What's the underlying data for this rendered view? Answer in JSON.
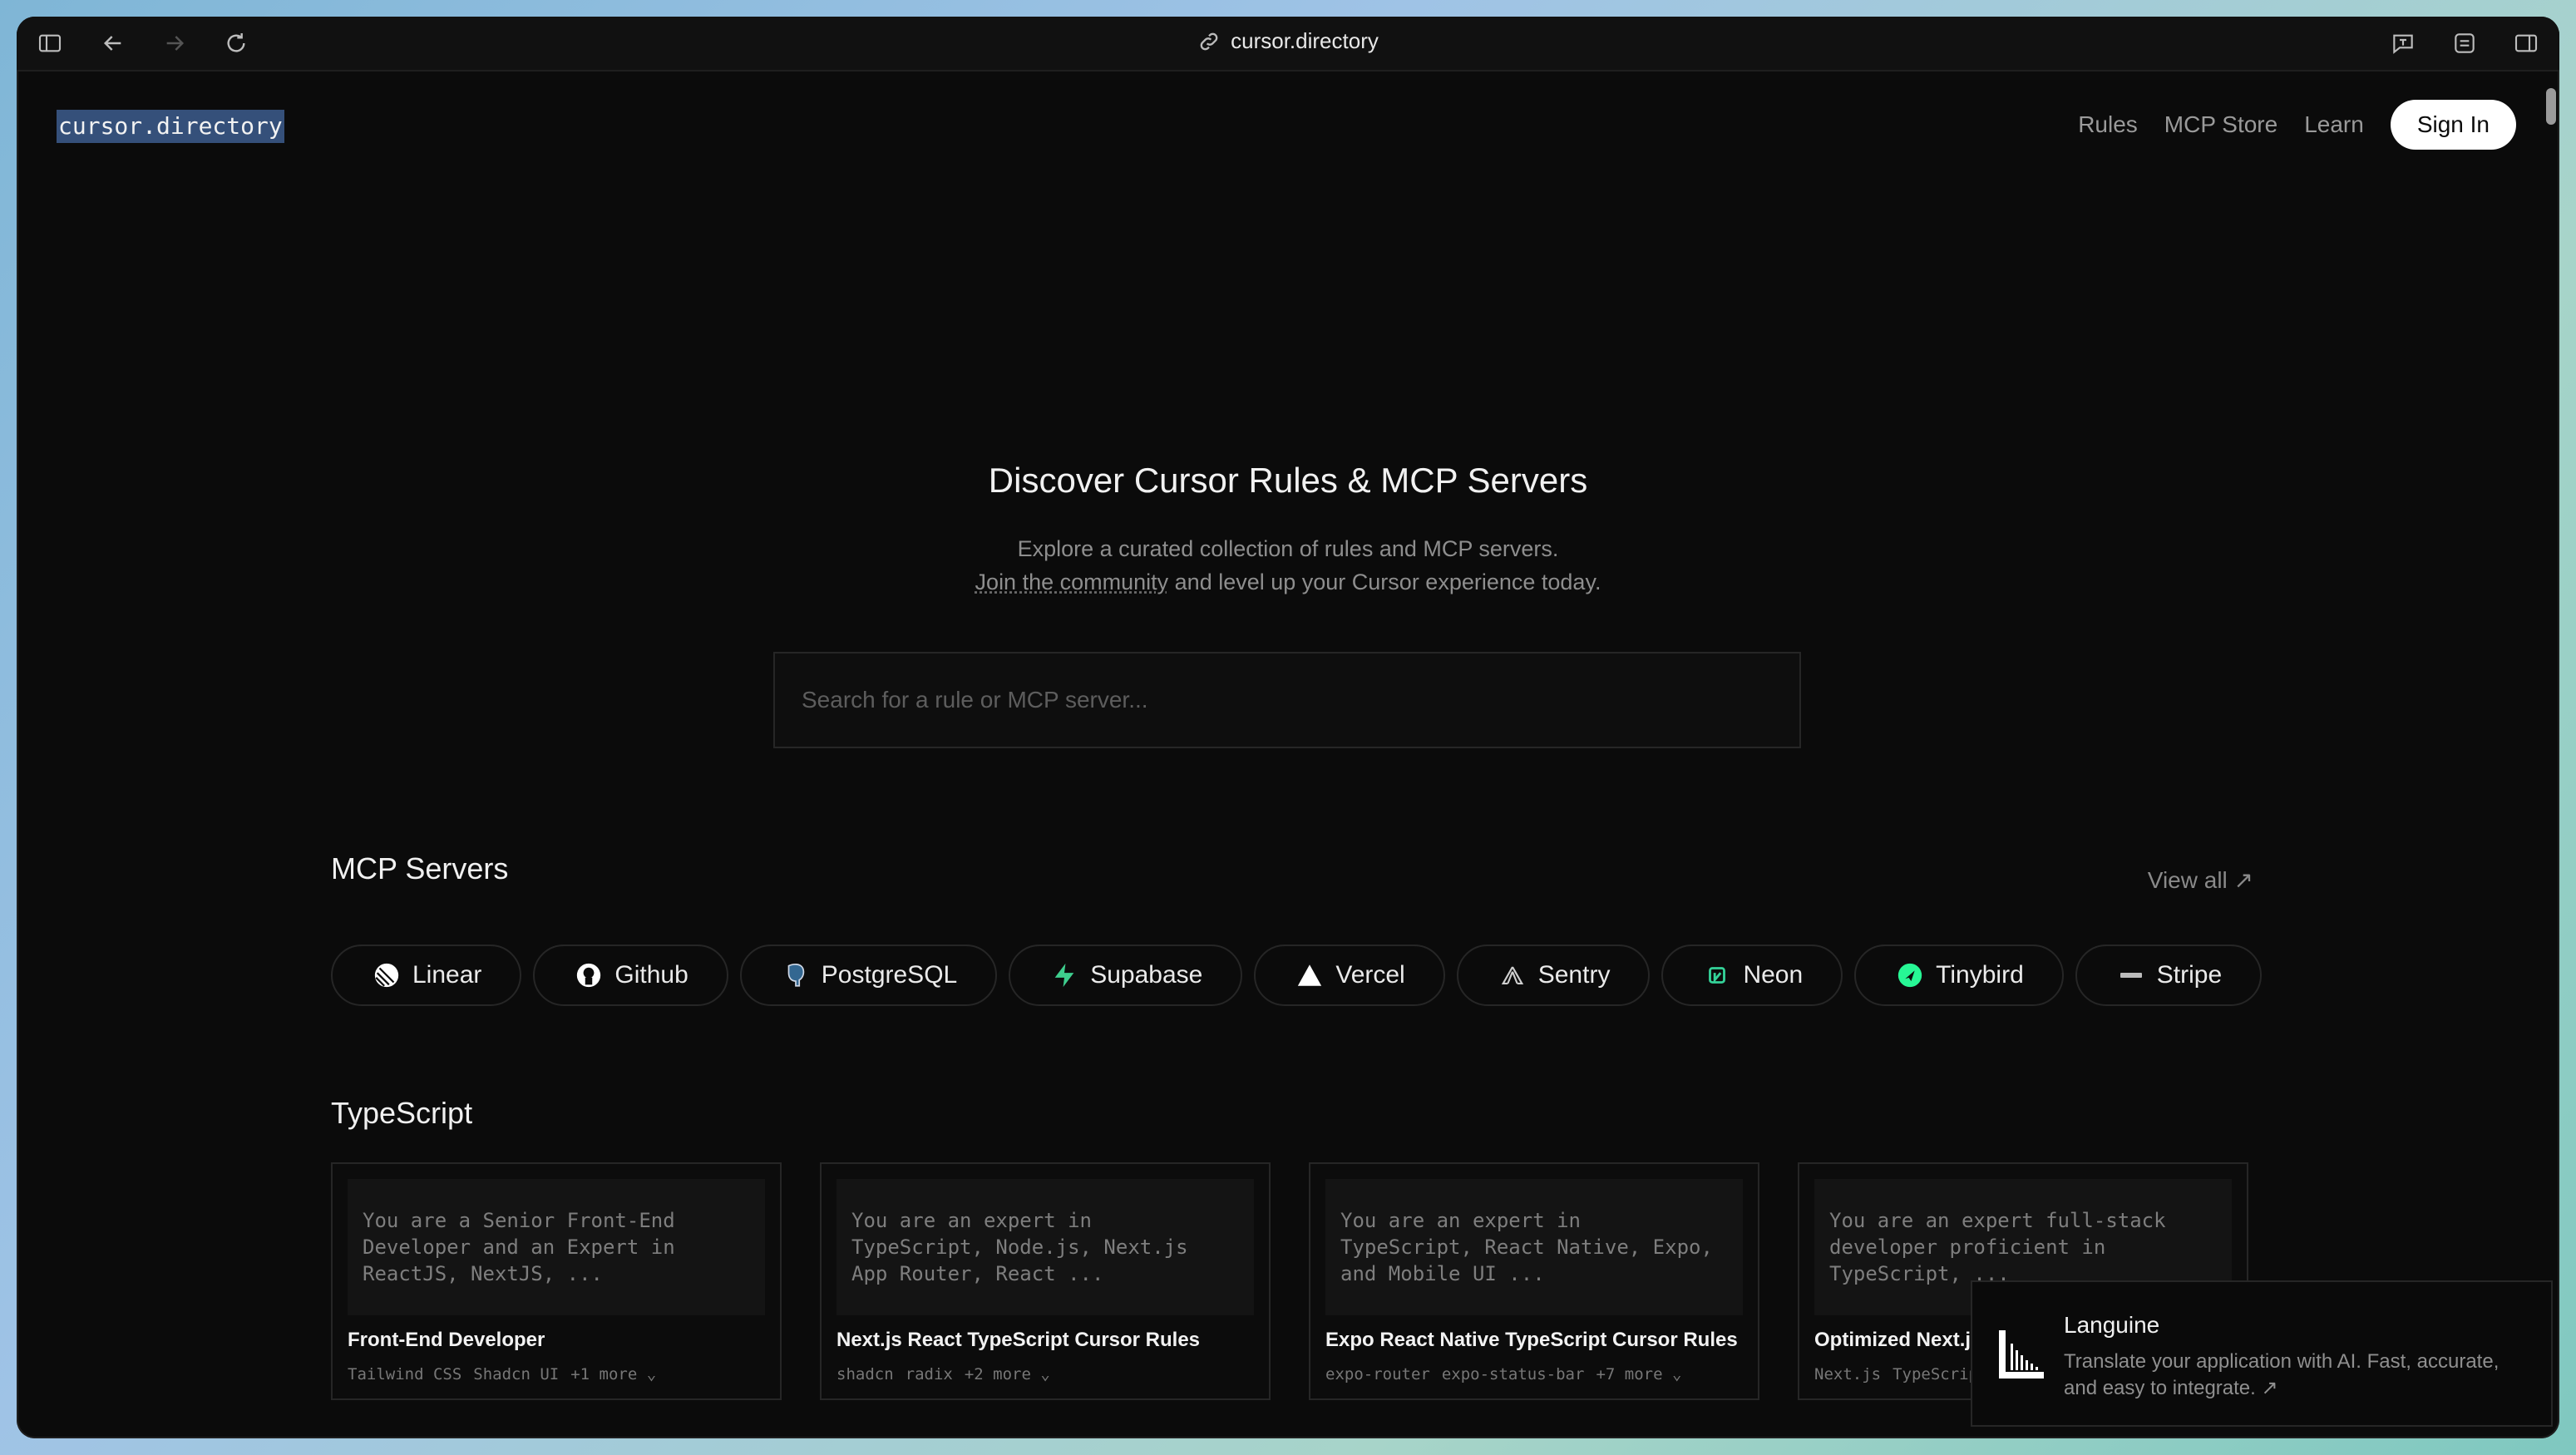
{
  "browser": {
    "url": "cursor.directory"
  },
  "header": {
    "logo": "cursor.directory",
    "nav": [
      "Rules",
      "MCP Store",
      "Learn"
    ],
    "sign_in": "Sign In"
  },
  "hero": {
    "title": "Discover Cursor Rules & MCP Servers",
    "line1": "Explore a curated collection of rules and MCP servers.",
    "line2_link": "Join the community",
    "line2_rest": " and level up your Cursor experience today.",
    "search_placeholder": "Search for a rule or MCP server..."
  },
  "mcp": {
    "title": "MCP Servers",
    "view_all": "View all ↗",
    "chips": [
      {
        "label": "Linear",
        "icon": "linear-icon"
      },
      {
        "label": "Github",
        "icon": "github-icon"
      },
      {
        "label": "PostgreSQL",
        "icon": "postgresql-icon"
      },
      {
        "label": "Supabase",
        "icon": "supabase-icon"
      },
      {
        "label": "Vercel",
        "icon": "vercel-icon"
      },
      {
        "label": "Sentry",
        "icon": "sentry-icon"
      },
      {
        "label": "Neon",
        "icon": "neon-icon"
      },
      {
        "label": "Tinybird",
        "icon": "tinybird-icon"
      },
      {
        "label": "Stripe",
        "icon": "stripe-icon"
      }
    ]
  },
  "typescript": {
    "title": "TypeScript",
    "cards": [
      {
        "code": "You are a Senior Front-End\nDeveloper and an Expert in\nReactJS, NextJS, ...",
        "title": "Front-End Developer",
        "tags": [
          "Tailwind CSS",
          "Shadcn UI",
          "+1 more ⌄"
        ]
      },
      {
        "code": "You are an expert in\nTypeScript, Node.js, Next.js\nApp Router, React ...",
        "title": "Next.js React TypeScript Cursor Rules",
        "tags": [
          "shadcn",
          "radix",
          "+2 more ⌄"
        ]
      },
      {
        "code": "You are an expert in\nTypeScript, React Native, Expo,\nand Mobile UI ...",
        "title": "Expo React Native TypeScript Cursor Rules",
        "tags": [
          "expo-router",
          "expo-status-bar",
          "+7 more ⌄"
        ]
      },
      {
        "code": "You are an expert full-stack\ndeveloper proficient in\nTypeScript, ...",
        "title": "Optimized Next.js TypeScript Best Practices",
        "tags": [
          "Next.js",
          "TypeScript"
        ]
      }
    ]
  },
  "toast": {
    "title": "Languine",
    "desc": "Translate your application with AI. Fast, accurate, and easy to integrate. ↗"
  }
}
